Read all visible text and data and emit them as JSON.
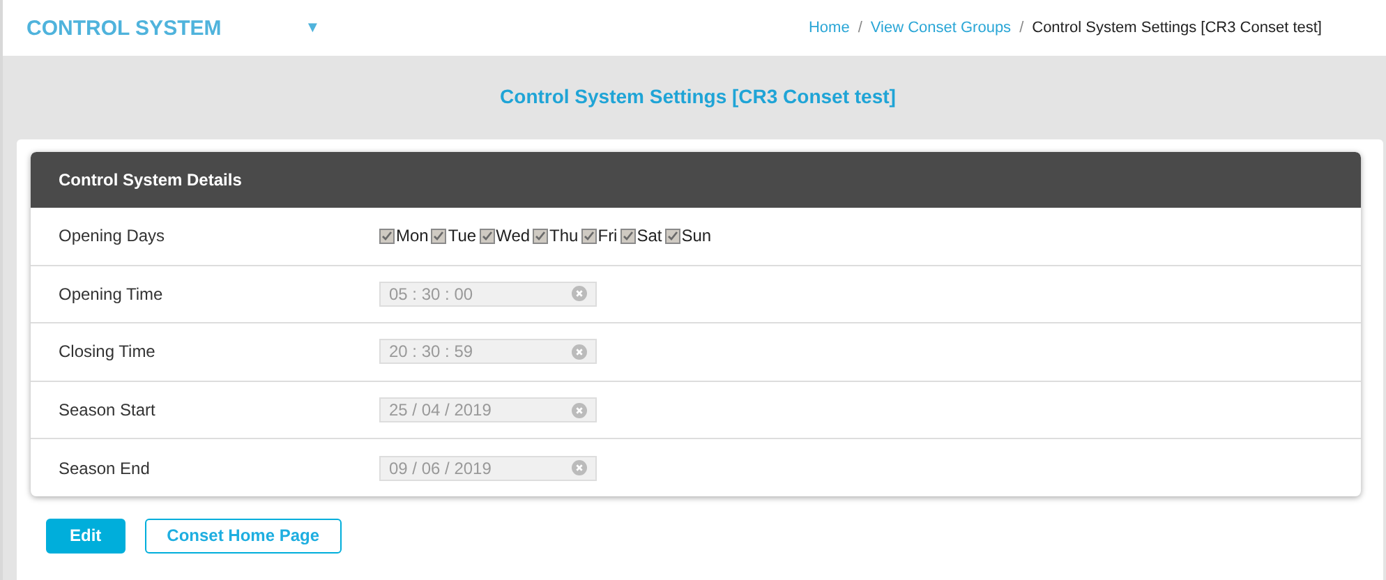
{
  "header": {
    "title": "CONTROL SYSTEM",
    "menu_caret": "▼",
    "breadcrumb_separator": "/",
    "breadcrumbs": [
      {
        "label": "Home",
        "current": false
      },
      {
        "label": "View Conset Groups",
        "current": false
      },
      {
        "label": "Control System Settings [CR3 Conset test]",
        "current": true
      }
    ]
  },
  "page_title": "Control System Settings [CR3 Conset test]",
  "panel": {
    "title": "Control System Details",
    "rows": [
      {
        "kind": "days",
        "label": "Opening Days",
        "days": [
          {
            "label": "Mon",
            "checked": true
          },
          {
            "label": "Tue",
            "checked": true
          },
          {
            "label": "Wed",
            "checked": true
          },
          {
            "label": "Thu",
            "checked": true
          },
          {
            "label": "Fri",
            "checked": true
          },
          {
            "label": "Sat",
            "checked": true
          },
          {
            "label": "Sun",
            "checked": true
          }
        ]
      },
      {
        "kind": "field",
        "label": "Opening Time",
        "value": "05 : 30 : 00",
        "disabled": true
      },
      {
        "kind": "field",
        "label": "Closing Time",
        "value": "20 : 30 : 59",
        "disabled": true
      },
      {
        "kind": "field",
        "label": "Season Start",
        "value": "25 / 04 / 2019",
        "disabled": true
      },
      {
        "kind": "field",
        "label": "Season End",
        "value": "09 / 06 / 2019",
        "disabled": true
      }
    ]
  },
  "buttons": [
    {
      "label": "Edit",
      "kind": "primary"
    },
    {
      "label": "Conset Home Page",
      "kind": "outline"
    }
  ]
}
